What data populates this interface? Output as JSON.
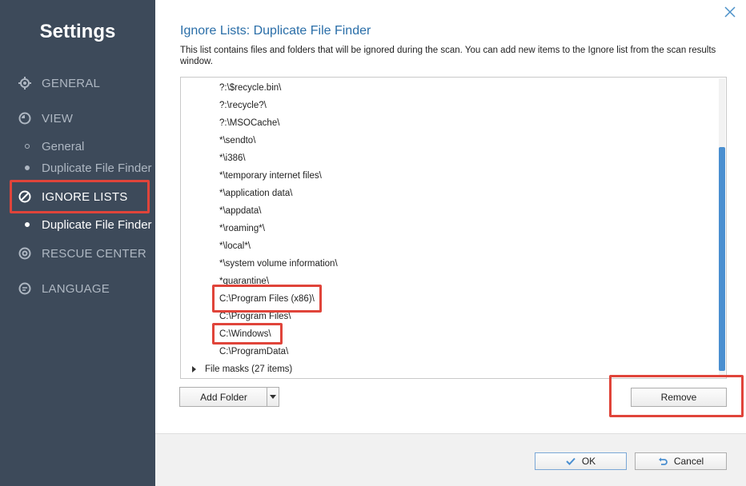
{
  "sidebar": {
    "title": "Settings",
    "nav": [
      {
        "label": "GENERAL",
        "icon": "gear-icon"
      },
      {
        "label": "VIEW",
        "icon": "view-icon"
      },
      {
        "label": "IGNORE LISTS",
        "icon": "ignore-icon"
      },
      {
        "label": "RESCUE CENTER",
        "icon": "rescue-icon"
      },
      {
        "label": "LANGUAGE",
        "icon": "language-icon"
      }
    ],
    "view_sub": [
      "General",
      "Duplicate File Finder"
    ],
    "ignore_sub": [
      "Duplicate File Finder"
    ]
  },
  "main": {
    "title": "Ignore Lists: Duplicate File Finder",
    "description": "This list contains files and folders that will be ignored during the scan. You can add new items to the Ignore list from the scan results window.",
    "items": [
      "?:\\$recycle.bin\\",
      "?:\\recycle?\\",
      "?:\\MSOCache\\",
      "*\\sendto\\",
      "*\\i386\\",
      "*\\temporary internet files\\",
      "*\\application data\\",
      "*\\appdata\\",
      "*\\roaming*\\",
      "*\\local*\\",
      "*\\system volume information\\",
      "*quarantine\\",
      "C:\\Program Files (x86)\\",
      "C:\\Program Files\\",
      "C:\\Windows\\",
      "C:\\ProgramData\\"
    ],
    "file_masks": "File masks (27 items)",
    "add_folder": "Add Folder",
    "remove": "Remove",
    "ok": "OK",
    "cancel": "Cancel"
  },
  "colors": {
    "sidebar_bg": "#3d4a5a",
    "accent": "#2a6ea8",
    "highlight": "#e0443a",
    "scroll_thumb": "#4a8fd0"
  }
}
